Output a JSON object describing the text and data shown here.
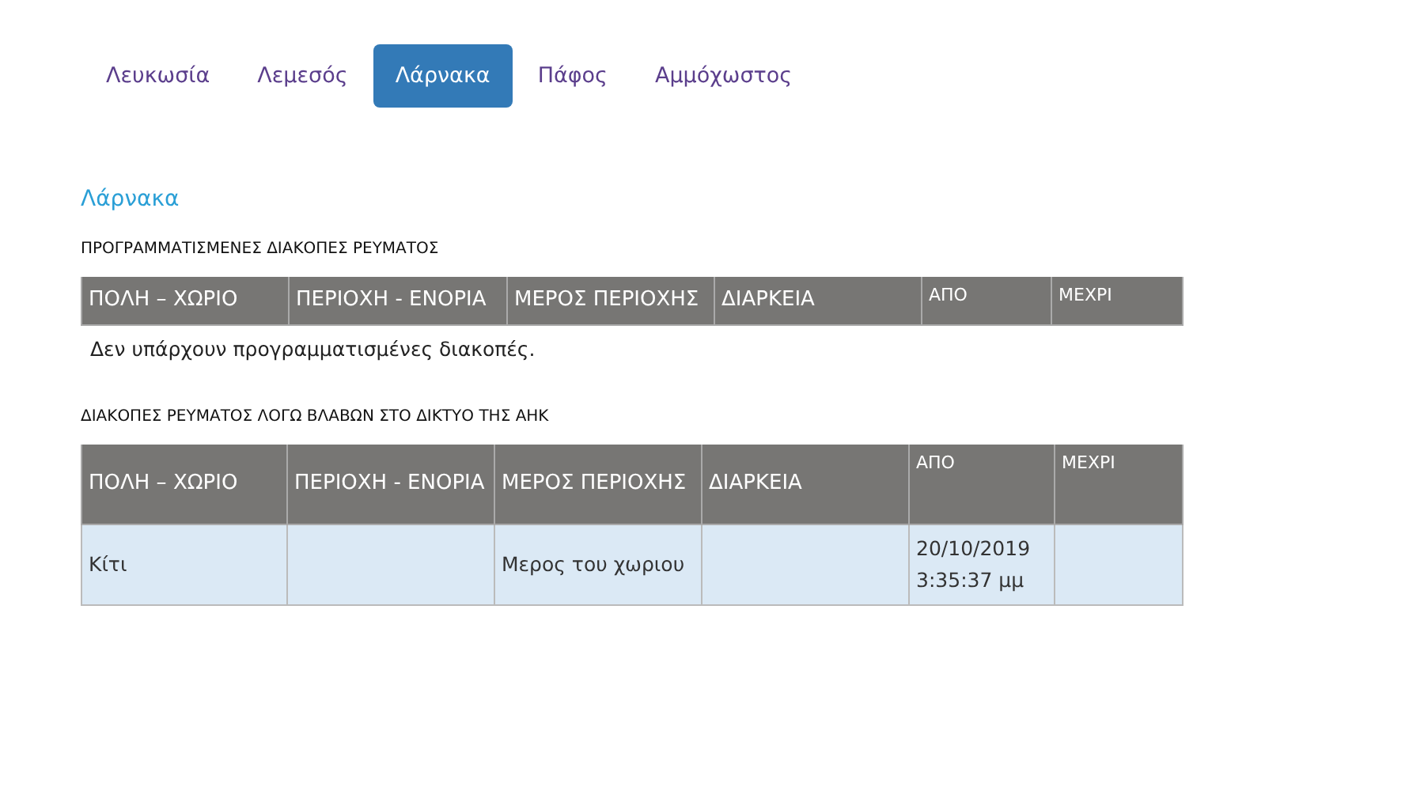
{
  "tabs": [
    {
      "label": "Λευκωσία",
      "selected": false
    },
    {
      "label": "Λεμεσός",
      "selected": false
    },
    {
      "label": "Λάρνακα",
      "selected": true
    },
    {
      "label": "Πάφος",
      "selected": false
    },
    {
      "label": "Αμμόχωστος",
      "selected": false
    }
  ],
  "heading": "Λάρνακα",
  "sections": [
    {
      "title": "ΠΡΟΓΡΑΜΜΑΤΙΣΜΕΝΕΣ ΔΙΑΚΟΠΕΣ ΡΕΥΜΑΤΟΣ",
      "columns": [
        {
          "label": "ΠΟΛΗ – ΧΩΡΙΟ",
          "kind": "large"
        },
        {
          "label": "ΠΕΡΙΟΧΗ - ΕΝΟΡΙΑ",
          "kind": "large"
        },
        {
          "label": "ΜΕΡΟΣ ΠΕΡΙΟΧΗΣ",
          "kind": "large"
        },
        {
          "label": "ΔΙΑΡΚΕΙΑ",
          "kind": "large"
        },
        {
          "label": "ΑΠΟ",
          "kind": "small"
        },
        {
          "label": "ΜΕΧΡΙ",
          "kind": "small"
        }
      ],
      "empty_message": "Δεν υπάρχουν προγραμματισμένες διακοπές."
    },
    {
      "title": "ΔΙΑΚΟΠΕΣ ΡΕΥΜΑΤΟΣ ΛΟΓΩ ΒΛΑΒΩΝ ΣΤΟ ΔΙΚΤΥΟ ΤΗΣ ΑΗΚ",
      "columns": [
        {
          "label": "ΠΟΛΗ – ΧΩΡΙΟ",
          "kind": "large"
        },
        {
          "label": "ΠΕΡΙΟΧΗ - ΕΝΟΡΙΑ",
          "kind": "large"
        },
        {
          "label": "ΜΕΡΟΣ ΠΕΡΙΟΧΗΣ",
          "kind": "large"
        },
        {
          "label": "ΔΙΑΡΚΕΙΑ",
          "kind": "large"
        },
        {
          "label": "ΑΠΟ",
          "kind": "small"
        },
        {
          "label": "ΜΕΧΡΙ",
          "kind": "small"
        }
      ],
      "rows": [
        [
          "Κίτι",
          "",
          "Μερος του χωριου",
          "",
          "20/10/2019 3:35:37 μμ",
          ""
        ]
      ]
    }
  ]
}
